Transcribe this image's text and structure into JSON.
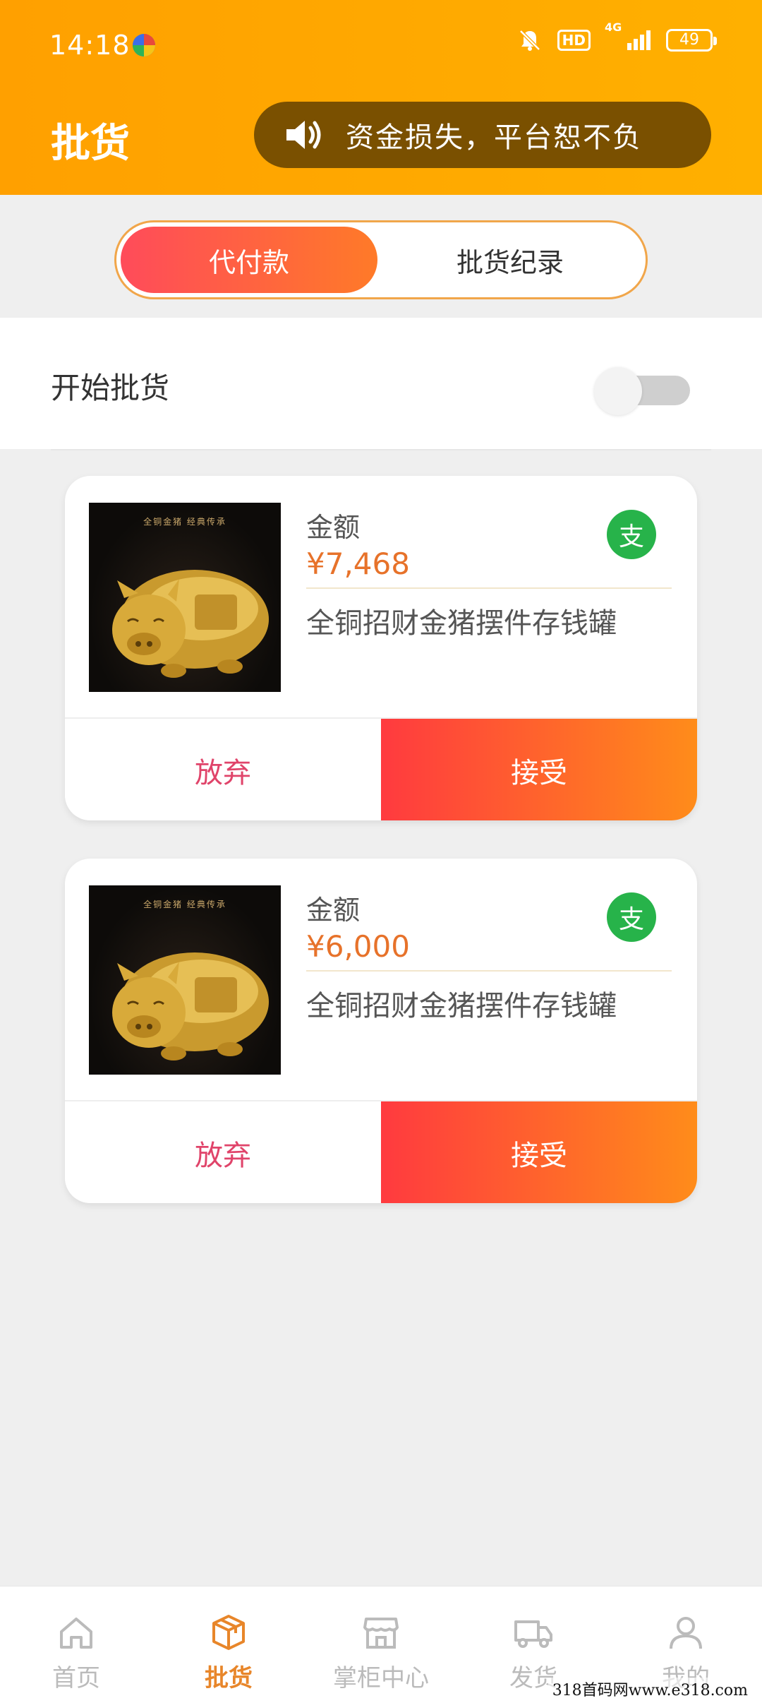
{
  "status_bar": {
    "time": "14:18",
    "network": "4G",
    "hd": "HD",
    "battery": "49"
  },
  "header": {
    "title": "批货",
    "notice": "资金损失，平台恕不负"
  },
  "tabs": [
    {
      "label": "代付款",
      "active": true
    },
    {
      "label": "批货纪录",
      "active": false
    }
  ],
  "toggle_row": {
    "label": "开始批货",
    "enabled": false
  },
  "orders": [
    {
      "amount_label": "金额",
      "amount": "¥7,468",
      "pay_badge": "支",
      "product_name": "全铜招财金猪摆件存钱罐",
      "image_caption": "全铜金猪 经典传承",
      "reject_label": "放弃",
      "accept_label": "接受"
    },
    {
      "amount_label": "金额",
      "amount": "¥6,000",
      "pay_badge": "支",
      "product_name": "全铜招财金猪摆件存钱罐",
      "image_caption": "全铜金猪 经典传承",
      "reject_label": "放弃",
      "accept_label": "接受"
    }
  ],
  "bottom_nav": [
    {
      "label": "首页",
      "icon": "home-icon",
      "active": false
    },
    {
      "label": "批货",
      "icon": "box-icon",
      "active": true
    },
    {
      "label": "掌柜中心",
      "icon": "store-icon",
      "active": false
    },
    {
      "label": "发货",
      "icon": "truck-icon",
      "active": false
    },
    {
      "label": "我的",
      "icon": "user-icon",
      "active": false
    }
  ],
  "watermark": "318首码网www.e318.com",
  "colors": {
    "header_bg": "#ffa800",
    "accent_orange": "#e8862a",
    "price": "#e7722a",
    "pay_green": "#27b34a",
    "reject_text": "#e0446a"
  }
}
